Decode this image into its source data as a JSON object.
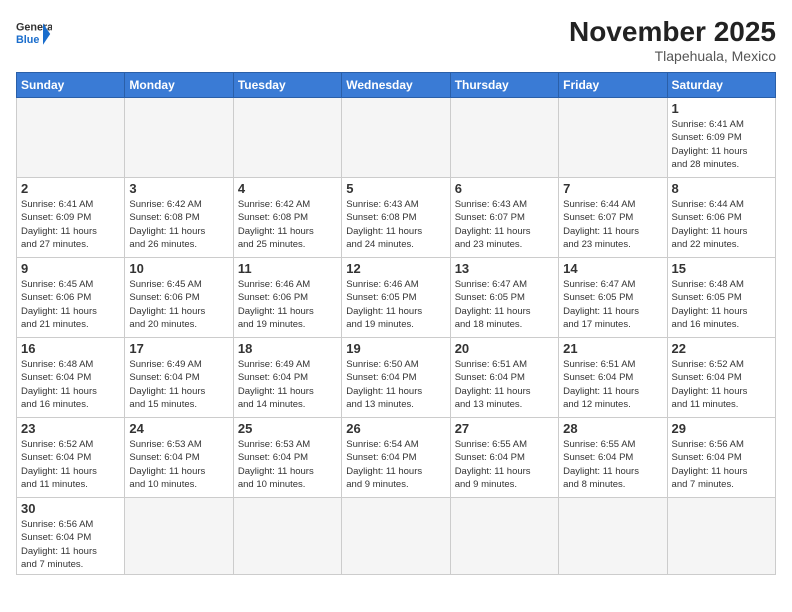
{
  "header": {
    "logo_general": "General",
    "logo_blue": "Blue",
    "month_title": "November 2025",
    "location": "Tlapehuala, Mexico"
  },
  "days_of_week": [
    "Sunday",
    "Monday",
    "Tuesday",
    "Wednesday",
    "Thursday",
    "Friday",
    "Saturday"
  ],
  "weeks": [
    [
      {
        "day": "",
        "info": ""
      },
      {
        "day": "",
        "info": ""
      },
      {
        "day": "",
        "info": ""
      },
      {
        "day": "",
        "info": ""
      },
      {
        "day": "",
        "info": ""
      },
      {
        "day": "",
        "info": ""
      },
      {
        "day": "1",
        "info": "Sunrise: 6:41 AM\nSunset: 6:09 PM\nDaylight: 11 hours\nand 28 minutes."
      }
    ],
    [
      {
        "day": "2",
        "info": "Sunrise: 6:41 AM\nSunset: 6:09 PM\nDaylight: 11 hours\nand 27 minutes."
      },
      {
        "day": "3",
        "info": "Sunrise: 6:42 AM\nSunset: 6:08 PM\nDaylight: 11 hours\nand 26 minutes."
      },
      {
        "day": "4",
        "info": "Sunrise: 6:42 AM\nSunset: 6:08 PM\nDaylight: 11 hours\nand 25 minutes."
      },
      {
        "day": "5",
        "info": "Sunrise: 6:43 AM\nSunset: 6:08 PM\nDaylight: 11 hours\nand 24 minutes."
      },
      {
        "day": "6",
        "info": "Sunrise: 6:43 AM\nSunset: 6:07 PM\nDaylight: 11 hours\nand 23 minutes."
      },
      {
        "day": "7",
        "info": "Sunrise: 6:44 AM\nSunset: 6:07 PM\nDaylight: 11 hours\nand 23 minutes."
      },
      {
        "day": "8",
        "info": "Sunrise: 6:44 AM\nSunset: 6:06 PM\nDaylight: 11 hours\nand 22 minutes."
      }
    ],
    [
      {
        "day": "9",
        "info": "Sunrise: 6:45 AM\nSunset: 6:06 PM\nDaylight: 11 hours\nand 21 minutes."
      },
      {
        "day": "10",
        "info": "Sunrise: 6:45 AM\nSunset: 6:06 PM\nDaylight: 11 hours\nand 20 minutes."
      },
      {
        "day": "11",
        "info": "Sunrise: 6:46 AM\nSunset: 6:06 PM\nDaylight: 11 hours\nand 19 minutes."
      },
      {
        "day": "12",
        "info": "Sunrise: 6:46 AM\nSunset: 6:05 PM\nDaylight: 11 hours\nand 19 minutes."
      },
      {
        "day": "13",
        "info": "Sunrise: 6:47 AM\nSunset: 6:05 PM\nDaylight: 11 hours\nand 18 minutes."
      },
      {
        "day": "14",
        "info": "Sunrise: 6:47 AM\nSunset: 6:05 PM\nDaylight: 11 hours\nand 17 minutes."
      },
      {
        "day": "15",
        "info": "Sunrise: 6:48 AM\nSunset: 6:05 PM\nDaylight: 11 hours\nand 16 minutes."
      }
    ],
    [
      {
        "day": "16",
        "info": "Sunrise: 6:48 AM\nSunset: 6:04 PM\nDaylight: 11 hours\nand 16 minutes."
      },
      {
        "day": "17",
        "info": "Sunrise: 6:49 AM\nSunset: 6:04 PM\nDaylight: 11 hours\nand 15 minutes."
      },
      {
        "day": "18",
        "info": "Sunrise: 6:49 AM\nSunset: 6:04 PM\nDaylight: 11 hours\nand 14 minutes."
      },
      {
        "day": "19",
        "info": "Sunrise: 6:50 AM\nSunset: 6:04 PM\nDaylight: 11 hours\nand 13 minutes."
      },
      {
        "day": "20",
        "info": "Sunrise: 6:51 AM\nSunset: 6:04 PM\nDaylight: 11 hours\nand 13 minutes."
      },
      {
        "day": "21",
        "info": "Sunrise: 6:51 AM\nSunset: 6:04 PM\nDaylight: 11 hours\nand 12 minutes."
      },
      {
        "day": "22",
        "info": "Sunrise: 6:52 AM\nSunset: 6:04 PM\nDaylight: 11 hours\nand 11 minutes."
      }
    ],
    [
      {
        "day": "23",
        "info": "Sunrise: 6:52 AM\nSunset: 6:04 PM\nDaylight: 11 hours\nand 11 minutes."
      },
      {
        "day": "24",
        "info": "Sunrise: 6:53 AM\nSunset: 6:04 PM\nDaylight: 11 hours\nand 10 minutes."
      },
      {
        "day": "25",
        "info": "Sunrise: 6:53 AM\nSunset: 6:04 PM\nDaylight: 11 hours\nand 10 minutes."
      },
      {
        "day": "26",
        "info": "Sunrise: 6:54 AM\nSunset: 6:04 PM\nDaylight: 11 hours\nand 9 minutes."
      },
      {
        "day": "27",
        "info": "Sunrise: 6:55 AM\nSunset: 6:04 PM\nDaylight: 11 hours\nand 9 minutes."
      },
      {
        "day": "28",
        "info": "Sunrise: 6:55 AM\nSunset: 6:04 PM\nDaylight: 11 hours\nand 8 minutes."
      },
      {
        "day": "29",
        "info": "Sunrise: 6:56 AM\nSunset: 6:04 PM\nDaylight: 11 hours\nand 7 minutes."
      }
    ],
    [
      {
        "day": "30",
        "info": "Sunrise: 6:56 AM\nSunset: 6:04 PM\nDaylight: 11 hours\nand 7 minutes."
      },
      {
        "day": "",
        "info": ""
      },
      {
        "day": "",
        "info": ""
      },
      {
        "day": "",
        "info": ""
      },
      {
        "day": "",
        "info": ""
      },
      {
        "day": "",
        "info": ""
      },
      {
        "day": "",
        "info": ""
      }
    ]
  ]
}
